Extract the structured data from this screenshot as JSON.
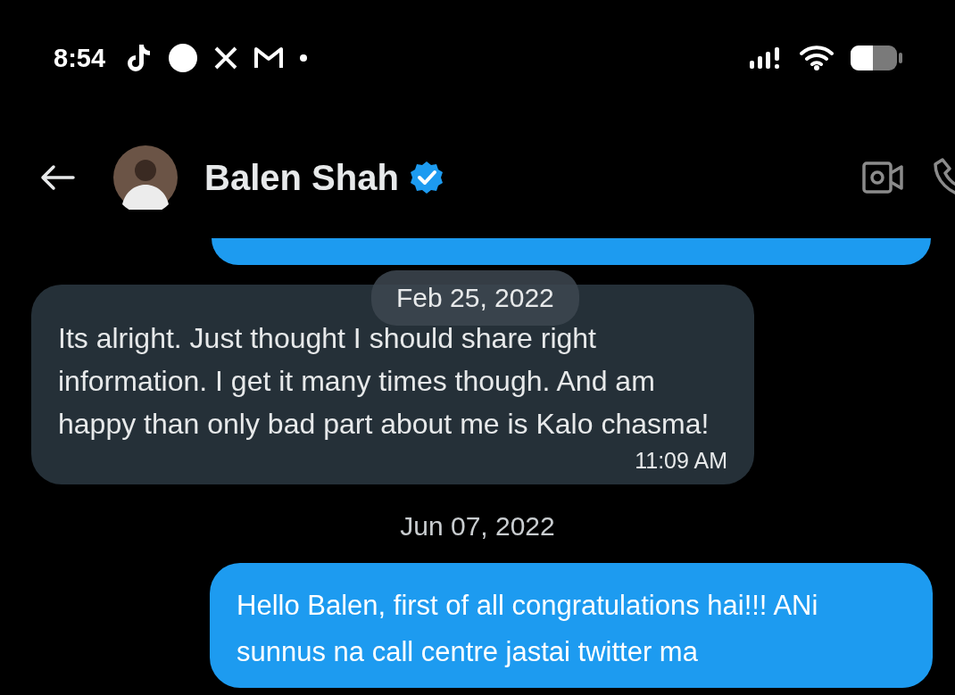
{
  "status_bar": {
    "time": "8:54"
  },
  "header": {
    "name": "Balen Shah",
    "verified": true
  },
  "floating_date": "Feb 25, 2022",
  "messages": [
    {
      "kind": "sent_partial"
    },
    {
      "kind": "received",
      "text": "Its alright. Just thought I should share right information. I get it many times though. And am happy than only bad part about me is Kalo chasma!",
      "time": "11:09 AM"
    },
    {
      "kind": "date",
      "text": "Jun 07, 2022"
    },
    {
      "kind": "sent",
      "text": "Hello Balen, first of all congratulations hai!!! ANi sunnus na call centre jastai twitter ma"
    }
  ]
}
